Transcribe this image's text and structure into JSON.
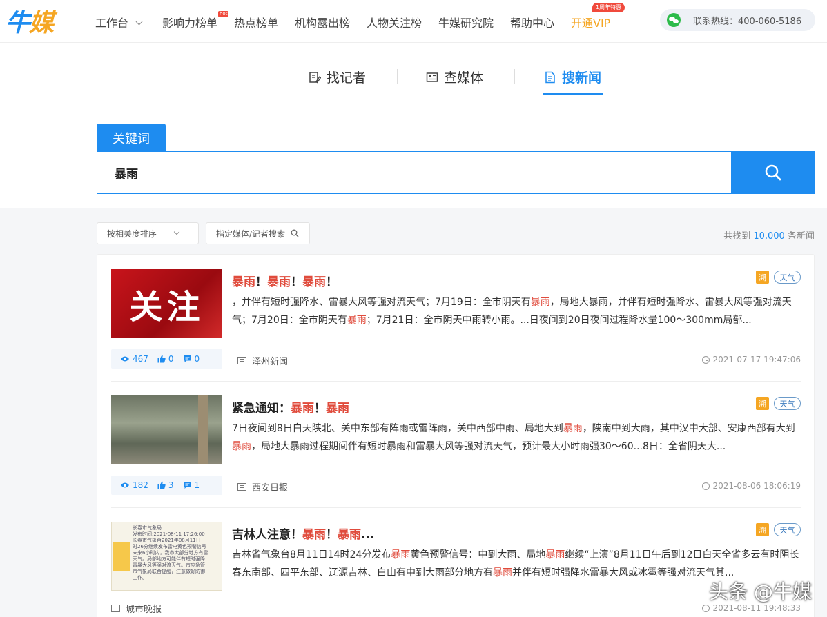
{
  "brand": {
    "logo_text_a": "牛",
    "logo_text_b": "媒"
  },
  "nav": {
    "items": [
      "工作台",
      "影响力榜单",
      "热点榜单",
      "机构露出榜",
      "人物关注榜",
      "牛媒研究院",
      "帮助中心",
      "开通VIP"
    ],
    "hot_badge": "hot",
    "vip_badge": "1周年特惠",
    "hotline": "联系热线：400-060-5186"
  },
  "tabs": [
    {
      "label": "找记者"
    },
    {
      "label": "查媒体"
    },
    {
      "label": "搜新闻"
    }
  ],
  "search": {
    "keyword_tab": "关键词",
    "value": "暴雨"
  },
  "filters": {
    "sort_label": "按相关度排序",
    "media_search_label": "指定媒体/记者搜索",
    "count_prefix": "共找到",
    "count_value": "10,000",
    "count_suffix": "条新闻"
  },
  "results": [
    {
      "thumb_text": "关注",
      "title_parts": [
        {
          "t": "暴雨",
          "hl": true
        },
        {
          "t": "！",
          "hl": false
        },
        {
          "t": "暴雨",
          "hl": true
        },
        {
          "t": "！",
          "hl": false
        },
        {
          "t": "暴雨",
          "hl": true
        },
        {
          "t": "！",
          "hl": false
        }
      ],
      "snippet_parts": [
        {
          "t": "，并伴有短时强降水、雷暴大风等强对流天气；7月19日：全市阴天有",
          "hl": false
        },
        {
          "t": "暴雨",
          "hl": true
        },
        {
          "t": "，局地大暴雨，并伴有短时强降水、雷暴大风等强对流天气；7月20日：全市阴天有",
          "hl": false
        },
        {
          "t": "暴雨",
          "hl": true
        },
        {
          "t": "；7月21日：全市阴天中雨转小雨。...日夜间到20日夜间过程降水量100～300mm局部...",
          "hl": false
        }
      ],
      "tag_source": "溯",
      "tag_category": "天气",
      "views": "467",
      "likes": "0",
      "comments": "0",
      "source": "泽州新闻",
      "time": "2021-07-17 19:47:06"
    },
    {
      "title_parts": [
        {
          "t": "紧急通知：",
          "hl": false
        },
        {
          "t": "暴雨",
          "hl": true
        },
        {
          "t": "！",
          "hl": false
        },
        {
          "t": "暴雨",
          "hl": true
        }
      ],
      "snippet_parts": [
        {
          "t": "7日夜间到8日白天陕北、关中东部有阵雨或雷阵雨，关中西部中雨、局地大到",
          "hl": false
        },
        {
          "t": "暴雨",
          "hl": true
        },
        {
          "t": "，陕南中到大雨，其中汉中大部、安康西部有大到",
          "hl": false
        },
        {
          "t": "暴雨",
          "hl": true
        },
        {
          "t": "，局地大暴雨过程期间伴有短时暴雨和雷暴大风等强对流天气，预计最大小时雨强30～60...8日：全省阴天大...",
          "hl": false
        }
      ],
      "tag_source": "溯",
      "tag_category": "天气",
      "views": "182",
      "likes": "3",
      "comments": "1",
      "source": "西安日报",
      "time": "2021-08-06 18:06:19"
    },
    {
      "thumb_lines": [
        "长春市气象局",
        "发布时间:2021-08-11 17:26:00",
        "长春市气象台2021年08月11日",
        "时26分继续发布雷电黄色预警信号",
        "未来6小时内，我市大部分地方有雷",
        "天气。局部地方可能伴有短时强降",
        "雷暴大风等强对流天气。市应急管",
        "市气象局联合提醒，注意做好防御",
        "工作。"
      ],
      "title_parts": [
        {
          "t": "吉林人注意！",
          "hl": false
        },
        {
          "t": "暴雨",
          "hl": true
        },
        {
          "t": "！",
          "hl": false
        },
        {
          "t": "暴雨",
          "hl": true
        },
        {
          "t": "...",
          "hl": false
        }
      ],
      "snippet_parts": [
        {
          "t": "吉林省气象台8月11日14时24分发布",
          "hl": false
        },
        {
          "t": "暴雨",
          "hl": true
        },
        {
          "t": "黄色预警信号：中到大雨、局地",
          "hl": false
        },
        {
          "t": "暴雨",
          "hl": true
        },
        {
          "t": "继续“上演”8月11日午后到12日白天全省多云有时阴长春东南部、四平东部、辽源吉林、白山有中到大雨部分地方有",
          "hl": false
        },
        {
          "t": "暴雨",
          "hl": true
        },
        {
          "t": "并伴有短时强降水雷暴大风或冰雹等强对流天气其...",
          "hl": false
        }
      ],
      "tag_source": "溯",
      "tag_category": "天气",
      "source": "城市晚报",
      "time": "2021-08-11 19:48:33"
    }
  ],
  "watermark": "头条 @牛媒"
}
